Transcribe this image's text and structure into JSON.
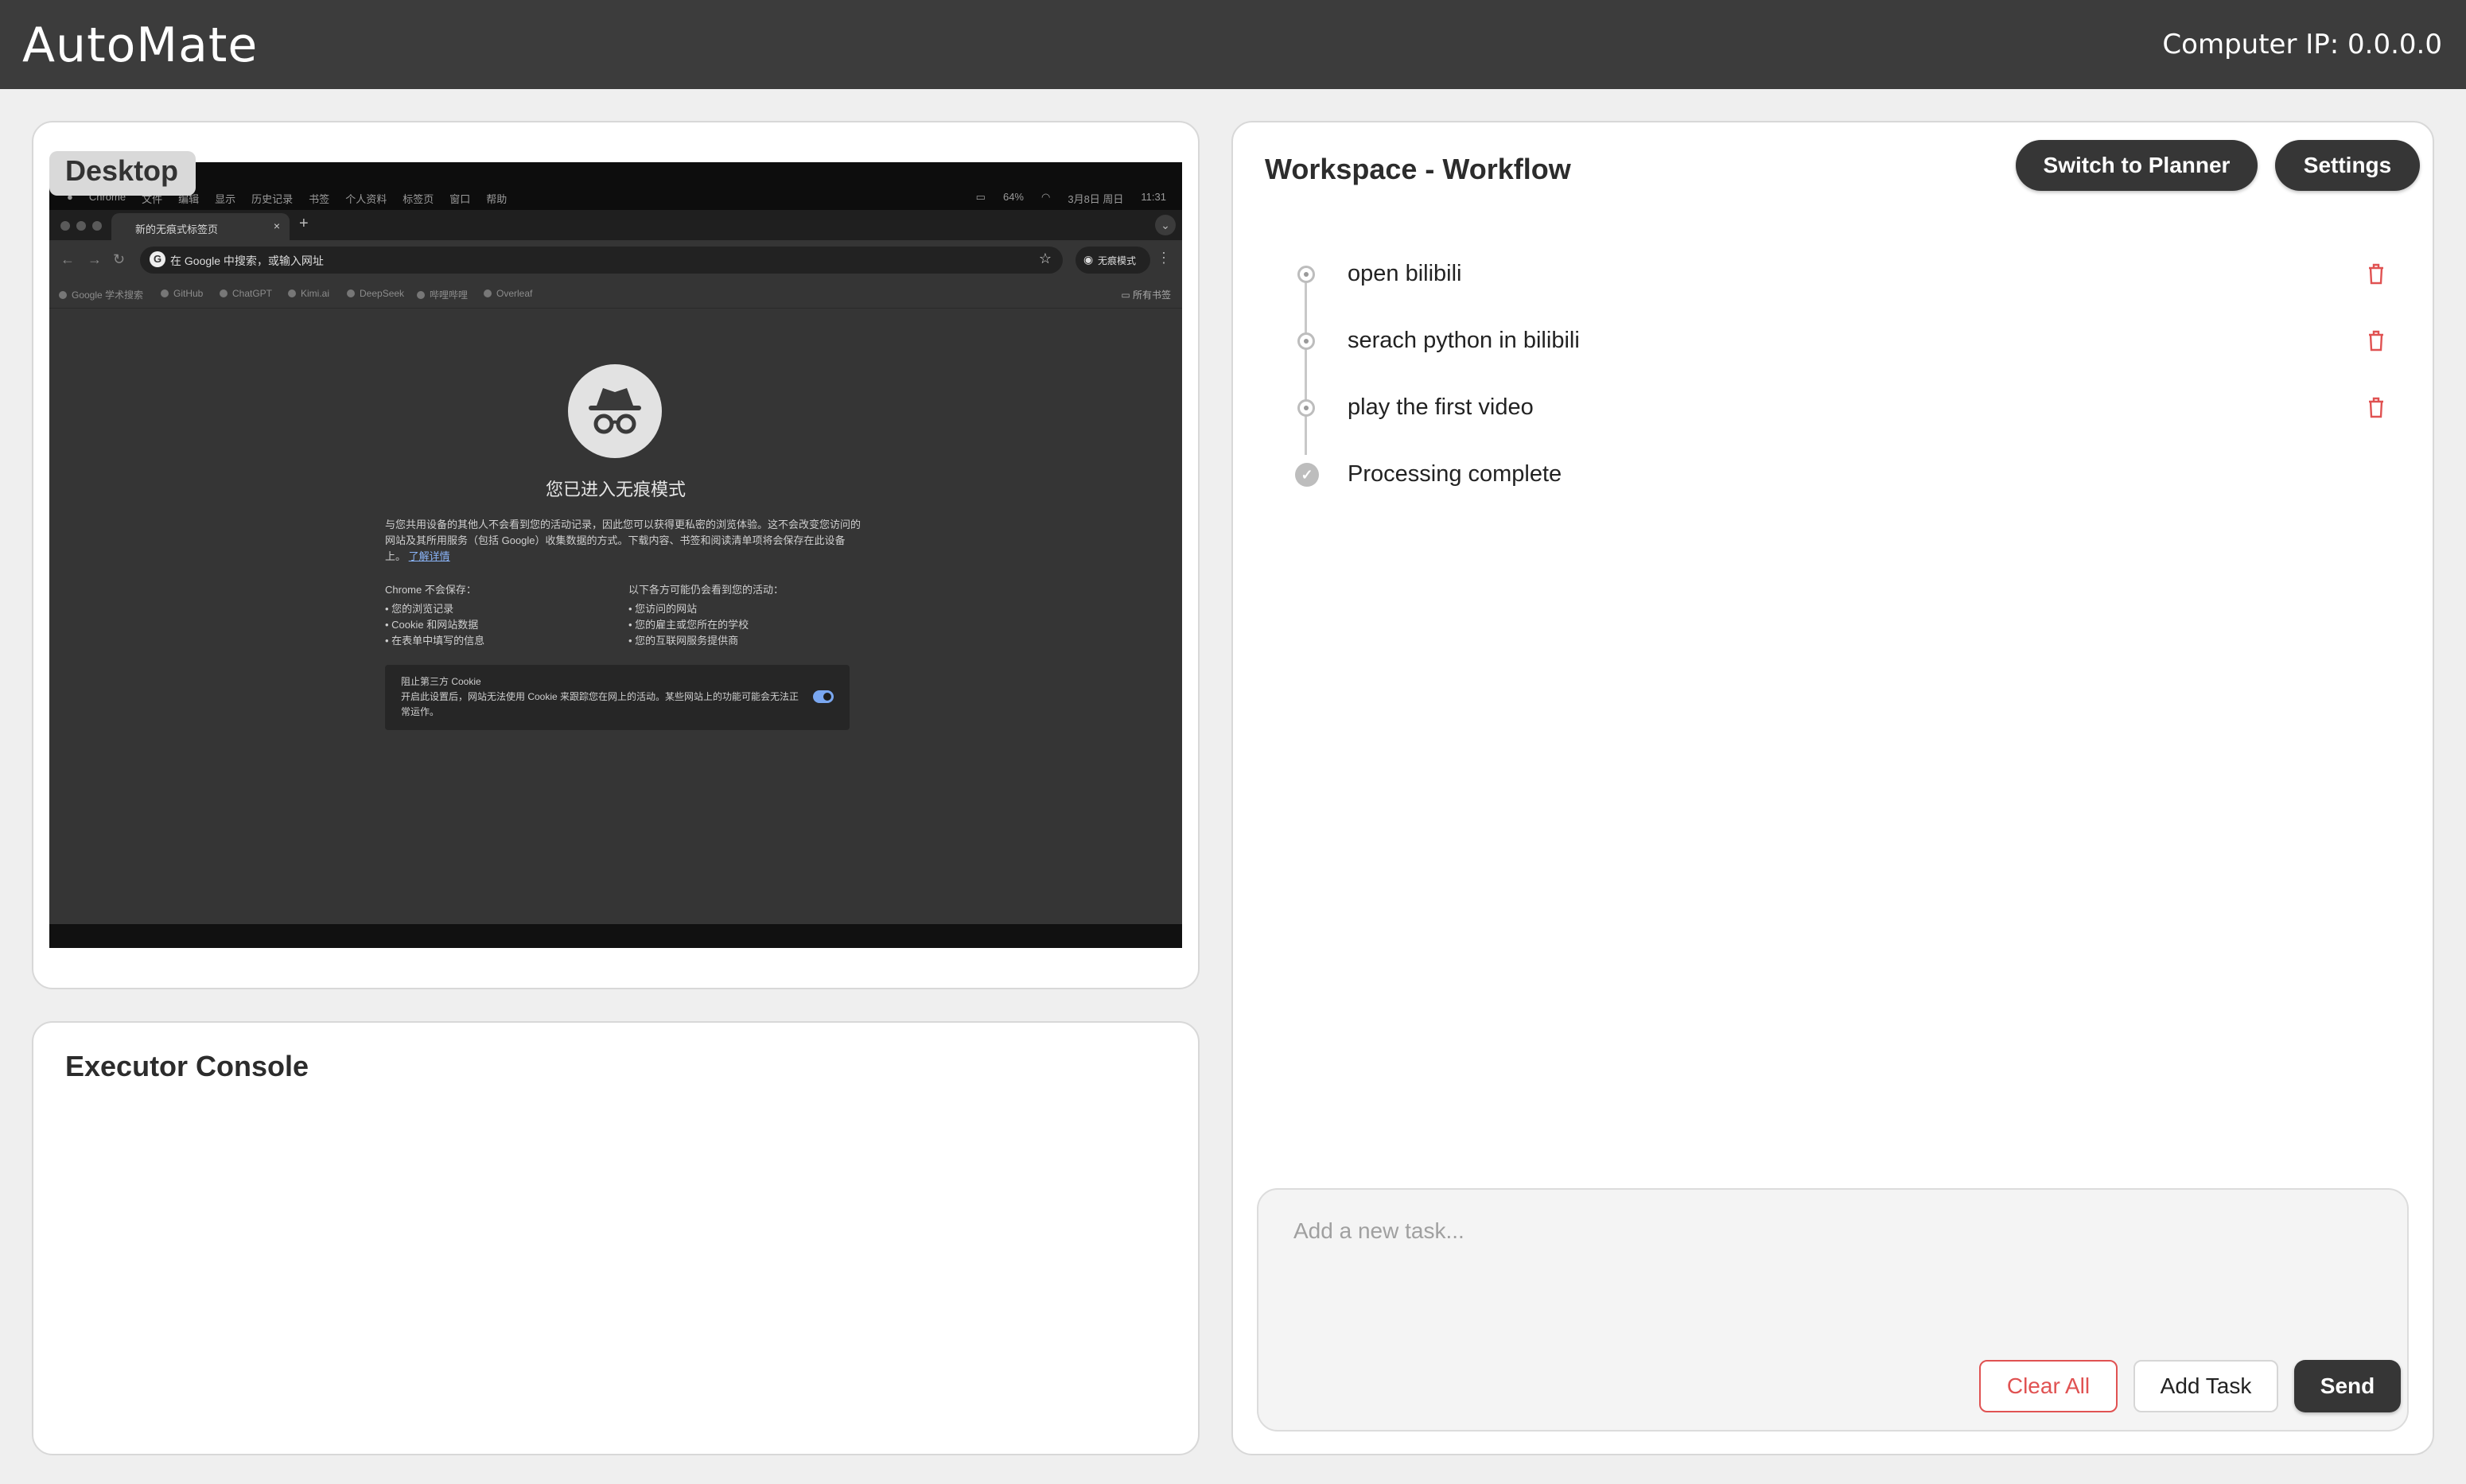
{
  "app": {
    "title": "AutoMate",
    "computer_ip": "Computer IP: 0.0.0.0"
  },
  "desktop": {
    "label": "Desktop",
    "screen": {
      "menubar_items": [
        "Chrome",
        "文件",
        "编辑",
        "显示",
        "历史记录",
        "书签",
        "个人资料",
        "标签页",
        "窗口",
        "帮助"
      ],
      "menubar_right": [
        "64%",
        "3月8日 周日",
        "11:31"
      ],
      "tab_title": "新的无痕式标签页",
      "tab_close": "×",
      "new_tab": "+",
      "address_placeholder": "在 Google 中搜索，或输入网址",
      "incognito_badge": "无痕模式",
      "bookmarks": [
        "Google 学术搜索",
        "GitHub",
        "ChatGPT",
        "Kimi.ai",
        "DeepSeek",
        "哔哩哔哩",
        "Overleaf"
      ],
      "bookmarks_all": "所有书签",
      "incognito_title": "您已进入无痕模式",
      "incognito_desc": "与您共用设备的其他人不会看到您的活动记录，因此您可以获得更私密的浏览体验。这不会改变您访问的网站及其所用服务（包括 Google）收集数据的方式。下载内容、书签和阅读清单项将会保存在此设备上。",
      "learn_more": "了解详情",
      "col_left_title": "Chrome 不会保存：",
      "col_left_items": [
        "您的浏览记录",
        "Cookie 和网站数据",
        "在表单中填写的信息"
      ],
      "col_right_title": "以下各方可能仍会看到您的活动：",
      "col_right_items": [
        "您访问的网站",
        "您的雇主或您所在的学校",
        "您的互联网服务提供商"
      ],
      "cookie_title": "阻止第三方 Cookie",
      "cookie_text": "开启此设置后，网站无法使用 Cookie 来跟踪您在网上的活动。某些网站上的功能可能会无法正常运作。"
    }
  },
  "console": {
    "title": "Executor Console"
  },
  "workspace": {
    "title": "Workspace - Workflow",
    "switch_button": "Switch to Planner",
    "settings_button": "Settings",
    "tasks": [
      {
        "label": "open bilibili",
        "status": "pending"
      },
      {
        "label": "serach python in bilibili",
        "status": "pending"
      },
      {
        "label": "play the first video",
        "status": "pending"
      },
      {
        "label": "Processing complete",
        "status": "done"
      }
    ],
    "input_placeholder": "Add a new task...",
    "clear_button": "Clear All",
    "add_button": "Add Task",
    "send_button": "Send"
  },
  "colors": {
    "topbar": "#3c3c3c",
    "danger": "#e05252",
    "dark_button": "#363636"
  }
}
